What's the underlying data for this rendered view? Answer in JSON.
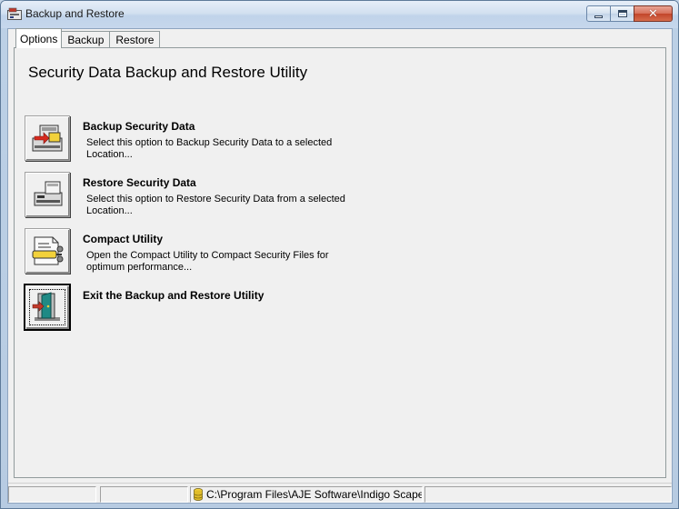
{
  "window": {
    "title": "Backup and Restore",
    "icons": {
      "app": "backup-app-icon",
      "minimize": "minimize-icon",
      "maximize": "maximize-icon",
      "close": "close-icon"
    }
  },
  "tabs": [
    {
      "label": "Options",
      "active": true
    },
    {
      "label": "Backup",
      "active": false
    },
    {
      "label": "Restore",
      "active": false
    }
  ],
  "page": {
    "title": "Security Data Backup and Restore Utility"
  },
  "options": [
    {
      "title": "Backup Security Data",
      "description": "Select this option to Backup Security Data to a selected Location...",
      "icon": "backup-drive-icon"
    },
    {
      "title": "Restore Security Data",
      "description": "Select this option to Restore Security Data from a selected Location...",
      "icon": "restore-drive-icon"
    },
    {
      "title": "Compact Utility",
      "description": "Open the Compact Utility to Compact Security Files for optimum performance...",
      "icon": "compact-utility-icon"
    },
    {
      "title": "Exit the Backup and Restore Utility",
      "description": "",
      "icon": "exit-door-icon"
    }
  ],
  "statusbar": {
    "panel1": "",
    "panel2": "",
    "path": "C:\\Program Files\\AJE Software\\Indigo Scape Star",
    "panel4": "",
    "path_icon": "database-icon"
  }
}
